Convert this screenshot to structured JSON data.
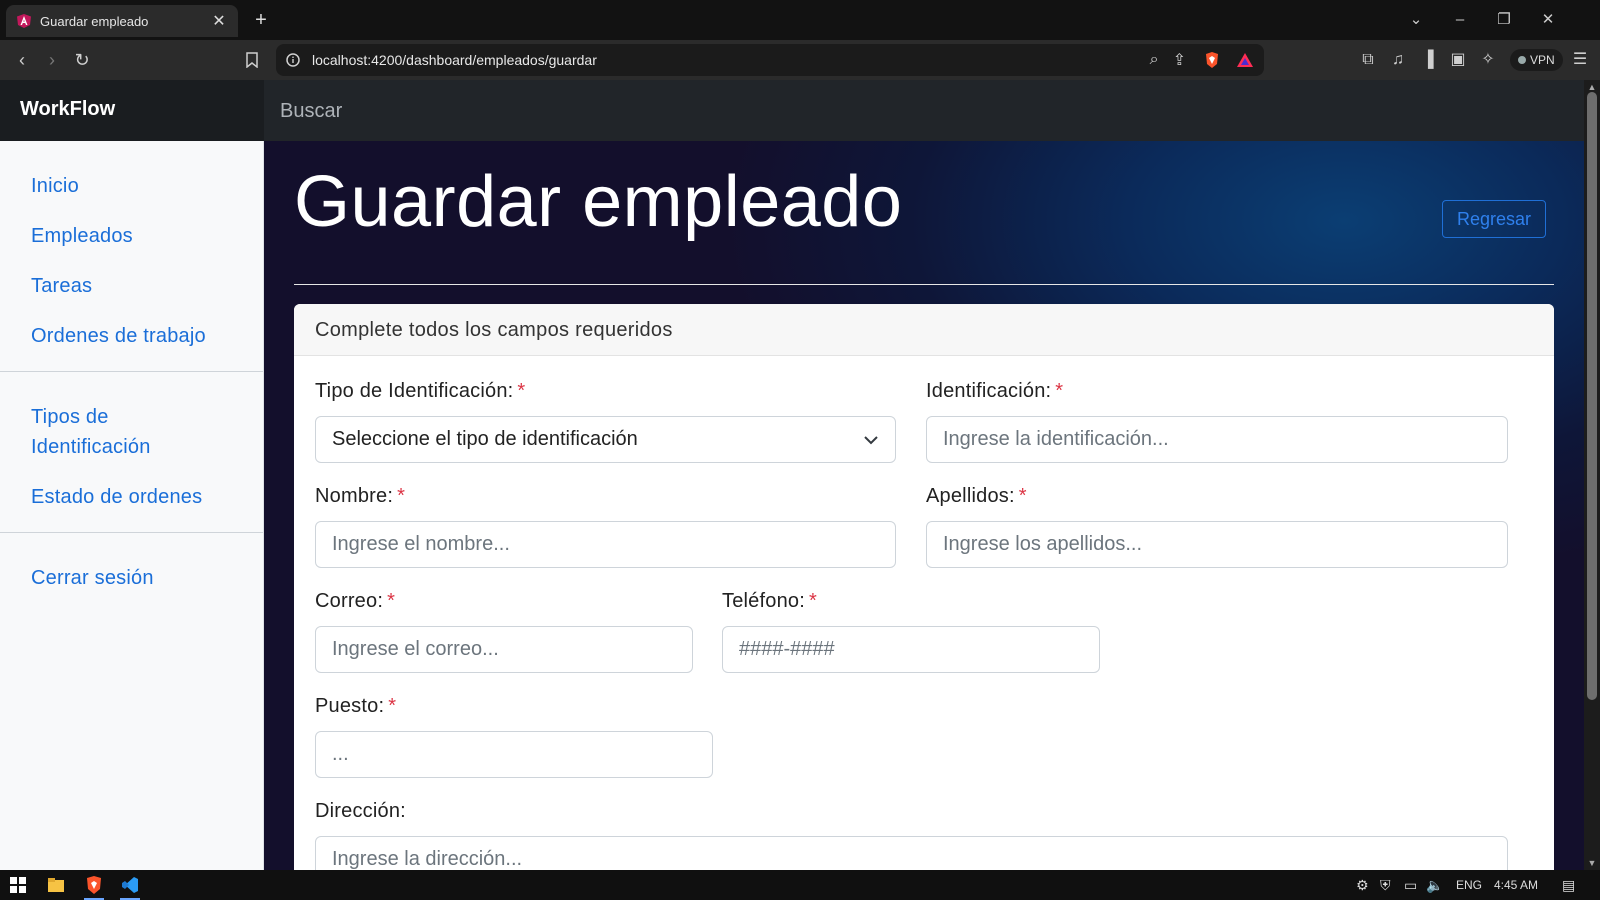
{
  "browser": {
    "tab_title": "Guardar empleado",
    "url": "localhost:4200/dashboard/empleados/guardar",
    "vpn_label": "VPN"
  },
  "app": {
    "brand": "WorkFlow",
    "search_placeholder": "Buscar"
  },
  "sidebar": {
    "main_items": [
      "Inicio",
      "Empleados",
      "Tareas",
      "Ordenes de trabajo"
    ],
    "catalog_items": [
      "Tipos de Identificación",
      "Estado de ordenes"
    ],
    "logout": "Cerrar sesión"
  },
  "page": {
    "title": "Guardar empleado",
    "back_label": "Regresar",
    "card_header": "Complete todos los campos requeridos"
  },
  "form": {
    "id_type_label": "Tipo de Identificación:",
    "id_type_selected": "Seleccione el tipo de identificación",
    "id_label": "Identificación:",
    "id_placeholder": "Ingrese la identificación...",
    "name_label": "Nombre:",
    "name_placeholder": "Ingrese el nombre...",
    "lastname_label": "Apellidos:",
    "lastname_placeholder": "Ingrese los apellidos...",
    "email_label": "Correo:",
    "email_placeholder": "Ingrese el correo...",
    "phone_label": "Teléfono:",
    "phone_placeholder": "####-####",
    "position_label": "Puesto:",
    "position_placeholder": "...",
    "address_label": "Dirección:",
    "address_placeholder": "Ingrese la dirección...",
    "required_mark": "*"
  },
  "taskbar": {
    "language": "ENG",
    "time": "4:45 AM"
  },
  "colors": {
    "link": "#1a6ed8",
    "required": "#dc3545",
    "appbar": "#212529"
  }
}
